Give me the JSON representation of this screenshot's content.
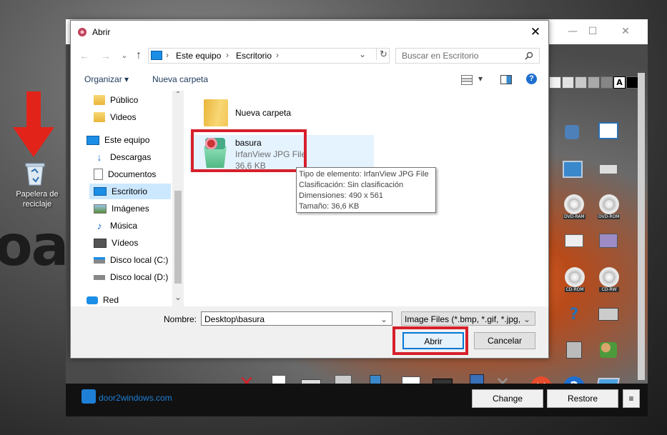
{
  "desktop": {
    "background_text": "oac",
    "recycle_bin_label": "Papelera de reciclaje"
  },
  "app": {
    "logo_text": "door2windows.com",
    "change_label": "Change",
    "restore_label": "Restore",
    "menu_label": "≡",
    "minimize_label": "—",
    "maximize_label": "☐",
    "close_label": "✕",
    "palette_letter": "A",
    "icon_labels": {
      "dvd_ram": "DVD-RAM",
      "dvd_rom": "DVD-ROM",
      "cd_rom": "CD-ROM",
      "cd_rw": "CD-RW",
      "question": "?"
    }
  },
  "dialog": {
    "title": "Abrir",
    "close_label": "✕",
    "back_label": "←",
    "forward_label": "→",
    "recent_label": "⌄",
    "up_label": "↑",
    "breadcrumb": [
      "Este equipo",
      "Escritorio"
    ],
    "breadcrumb_sep": "›",
    "addr_dropdown": "⌄",
    "refresh_label": "↻",
    "search_placeholder": "Buscar en Escritorio",
    "toolbar": {
      "organize_label": "Organizar",
      "organize_caret": "▾",
      "new_folder_label": "Nueva carpeta",
      "view_caret": "▾",
      "help_label": "?"
    },
    "nav_items": [
      {
        "label": "Público",
        "icon": "folder-icon"
      },
      {
        "label": "Videos",
        "icon": "folder-icon"
      },
      {
        "label": "Este equipo",
        "icon": "computer-icon"
      },
      {
        "label": "Descargas",
        "icon": "download-icon"
      },
      {
        "label": "Documentos",
        "icon": "document-icon"
      },
      {
        "label": "Escritorio",
        "icon": "desktop-icon"
      },
      {
        "label": "Imágenes",
        "icon": "pictures-icon"
      },
      {
        "label": "Música",
        "icon": "music-icon"
      },
      {
        "label": "Vídeos",
        "icon": "video-icon"
      },
      {
        "label": "Disco local (C:)",
        "icon": "drive-icon"
      },
      {
        "label": "Disco local (D:)",
        "icon": "drive-icon"
      },
      {
        "label": "Red",
        "icon": "network-icon"
      }
    ],
    "scroll_up": "⌃",
    "scroll_down": "⌄",
    "files": [
      {
        "name": "Nueva carpeta"
      },
      {
        "name": "basura",
        "type": "IrfanView JPG File",
        "size": "36,6 KB"
      }
    ],
    "tooltip": {
      "line1": "Tipo de elemento: IrfanView JPG File",
      "line2": "Clasificación: Sin clasificación",
      "line3": "Dimensiones: 490 x 561",
      "line4": "Tamaño: 36,6 KB"
    },
    "filename_label": "Nombre:",
    "filename_value": "Desktop\\basura",
    "filename_caret": "⌄",
    "filter_value": "Image Files (*.bmp, *.gif, *.jpg,",
    "filter_caret": "⌄",
    "open_label": "Abrir",
    "cancel_label": "Cancelar"
  },
  "colors": {
    "highlight_red": "#d6202b",
    "selection_blue": "#cce8ff",
    "accent_blue": "#1e7fd6"
  }
}
